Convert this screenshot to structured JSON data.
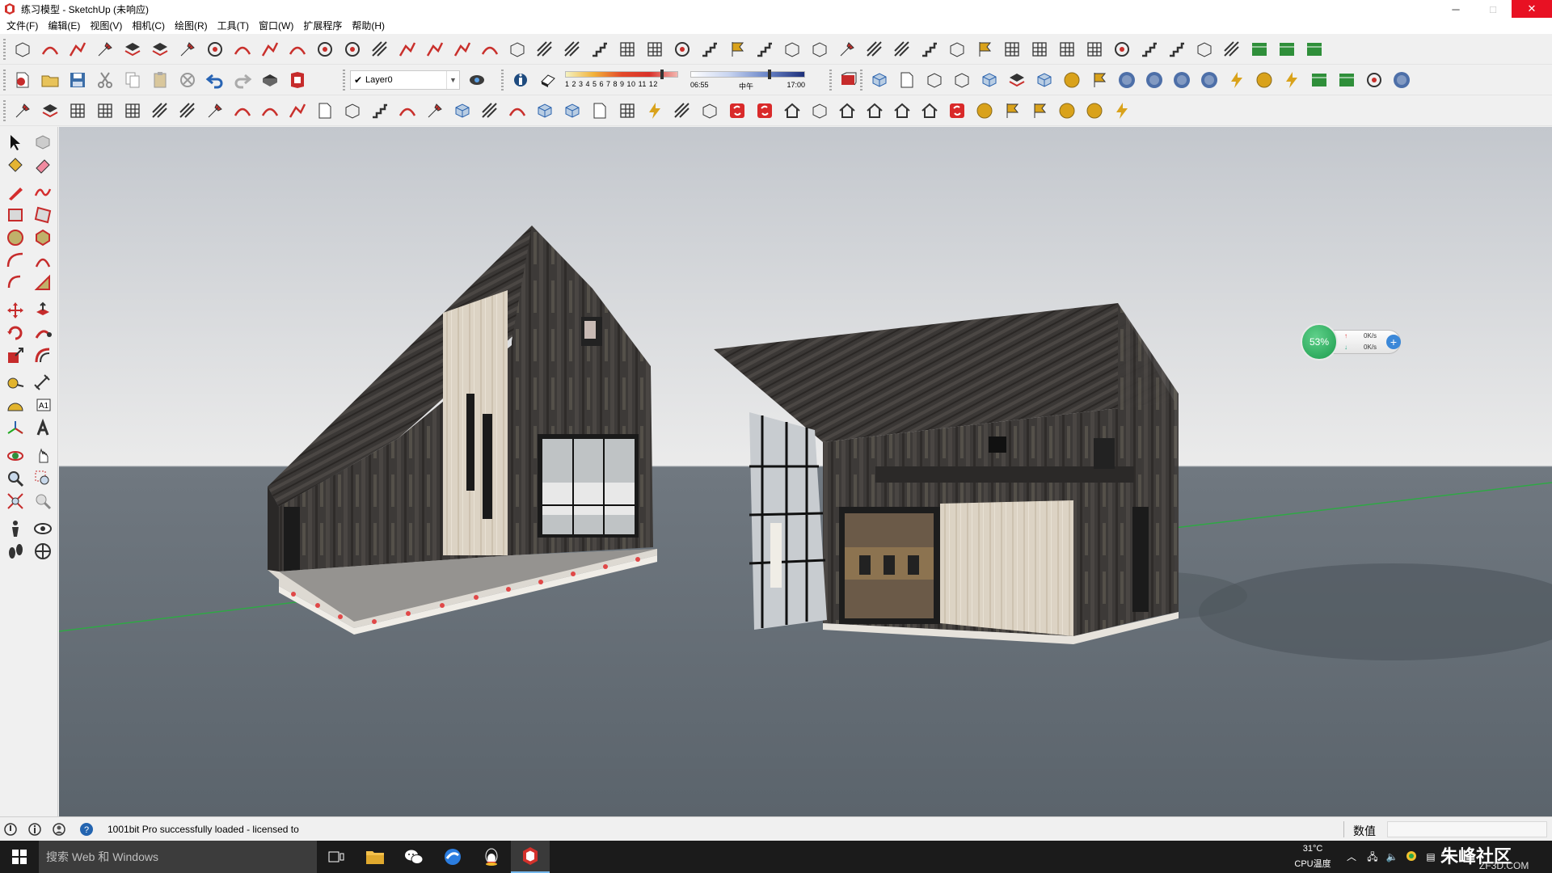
{
  "window": {
    "title": "练习模型 - SketchUp (未响应)",
    "minimize_glyph": "─",
    "maximize_glyph": "□",
    "close_glyph": "✕"
  },
  "menu": [
    {
      "label": "文件(F)"
    },
    {
      "label": "编辑(E)"
    },
    {
      "label": "视图(V)"
    },
    {
      "label": "相机(C)"
    },
    {
      "label": "绘图(R)"
    },
    {
      "label": "工具(T)"
    },
    {
      "label": "窗口(W)"
    },
    {
      "label": "扩展程序"
    },
    {
      "label": "帮助(H)"
    }
  ],
  "layers": {
    "current": "Layer0",
    "check_glyph": "✔",
    "dropdown_glyph": "▼"
  },
  "shadows": {
    "months_ticks": "1 2 3 4 5 6 7 8 9 10 11 12",
    "time_start": "06:55",
    "time_mid": "中午",
    "time_end": "17:00"
  },
  "net_widget": {
    "percent": "53%",
    "up": "0K/s",
    "down": "0K/s",
    "up_arrow": "↑",
    "down_arrow": "↓",
    "plus": "+"
  },
  "status": {
    "message": "1001bit Pro successfully loaded - licensed to",
    "measure_label": "数值",
    "measure_value": ""
  },
  "taskbar": {
    "search_placeholder": "搜索 Web 和 Windows",
    "temperature": "31°C",
    "cpu_label": "CPU温度",
    "watermark": "朱峰社区",
    "watermark_sub": "ZF3D.COM"
  },
  "colors": {
    "sky_top": "#c3c7cd",
    "sky_bottom": "#e9eaeb",
    "ground": "#616a72",
    "dark_wood": "#3b3836",
    "light_wood": "#d9d0c1",
    "axis_green": "#2fa845",
    "close_red": "#e81123"
  }
}
